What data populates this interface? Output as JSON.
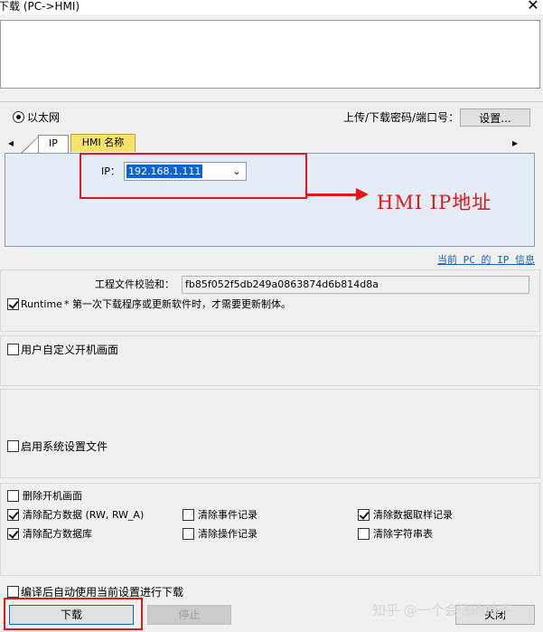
{
  "window": {
    "title": "下载 (PC->HMI)",
    "close_glyph": "✕"
  },
  "connection": {
    "ethernet_label": "以太网",
    "password_port_label": "上传/下载密码/端口号：",
    "settings_button": "设置...",
    "scroll_left": "◂",
    "scroll_right": "▸"
  },
  "tabs": [
    {
      "label": "IP"
    },
    {
      "label": "HMI 名称"
    }
  ],
  "ip_panel": {
    "ip_label": "IP：",
    "ip_value": "192.168.1.111",
    "chevron": "⌄"
  },
  "annotation": {
    "text": "HMI IP地址",
    "color": "#e11818"
  },
  "pc_ip_link": "当前 PC 的 IP 信息",
  "project": {
    "checksum_label": "工程文件校验和：",
    "checksum_value": "fb85f052f5db249a0863874d6b814d8a",
    "runtime_label": "Runtime",
    "runtime_checked": true,
    "runtime_note": "* 第一次下载程序或更新软件时，才需要更新制体。"
  },
  "options": {
    "custom_startup_label": "用户自定义开机画面",
    "system_settings_label": "启用系统设置文件",
    "delete_startup_label": "删除开机画面",
    "clear_recipe_label": "清除配方数据 (RW, RW_A)",
    "clear_events_label": "清除事件记录",
    "clear_sampling_label": "清除数据取样记录",
    "clear_recipe_db_label": "清除配方数据库",
    "clear_operations_label": "清除操作记录",
    "clear_strings_label": "清除字符串表",
    "auto_download_label": "编译后自动使用当前设置进行下载"
  },
  "buttons": {
    "download": "下载",
    "stop": "停止",
    "close": "关闭"
  },
  "watermark": "知乎 @一个会飞的柚子",
  "colors": {
    "accent_red": "#e11818",
    "tab_yellow": "#f7e26b",
    "selection_blue": "#0a64d6",
    "link_blue": "#1b5fbf"
  }
}
